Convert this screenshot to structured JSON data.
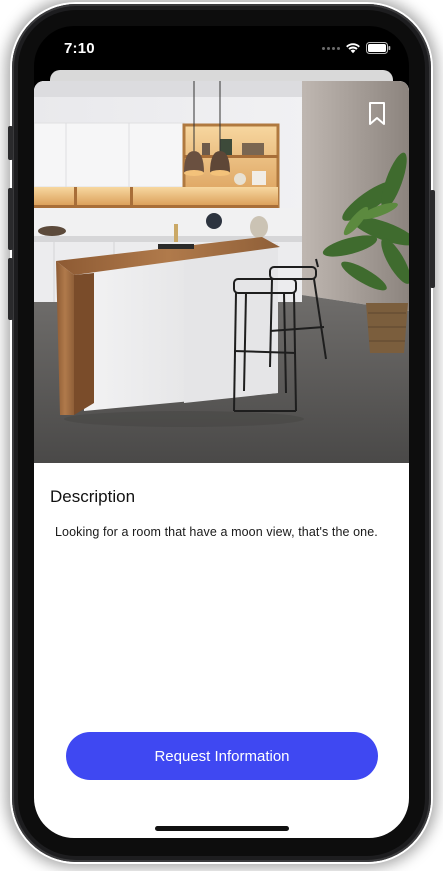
{
  "status_bar": {
    "time": "7:10",
    "icons": [
      "signal-dots-icon",
      "wifi-icon",
      "battery-icon"
    ]
  },
  "listing": {
    "image_alt": "Modern kitchen with wooden counter and bar stools",
    "bookmark_icon": "bookmark-icon"
  },
  "description": {
    "heading": "Description",
    "text": "Looking for a room that have a moon view, that's the one."
  },
  "actions": {
    "request_label": "Request Information",
    "button_color": "#3f48f2"
  }
}
